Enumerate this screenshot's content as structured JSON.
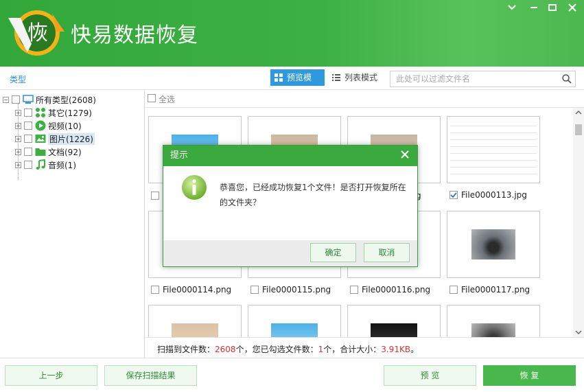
{
  "app": {
    "title": "快易数据恢复",
    "logo_char": "恢"
  },
  "window_controls": {
    "minimize": "—",
    "maximize": "□",
    "close": "✕"
  },
  "toolbar": {
    "type_label": "类型",
    "preview_mode": "预览模式",
    "list_mode": "列表模式",
    "filter_placeholder": "此处可以过滤文件名"
  },
  "tree": {
    "root": "所有类型(2608)",
    "items": [
      {
        "label": "其它(1279)",
        "icon": "apps-icon"
      },
      {
        "label": "视频(10)",
        "icon": "video-icon"
      },
      {
        "label": "图片(1226)",
        "icon": "image-icon",
        "selected": true
      },
      {
        "label": "文档(92)",
        "icon": "folder-icon"
      },
      {
        "label": "音频(1)",
        "icon": "music-icon"
      }
    ]
  },
  "grid": {
    "select_all": "全选",
    "row1_names": [
      "",
      "",
      ".png",
      "File0000113.jpg"
    ],
    "row2_names": [
      "File0000114.png",
      "File0000115.png",
      "File0000116.png",
      "File0000117.png"
    ]
  },
  "status": {
    "scanned_label": "扫描到文件数：",
    "scanned_count": "2608",
    "selected_label": "个，您已勾选文件数：",
    "selected_count": "1",
    "size_label": "个，合计大小：",
    "size_value": "3.91KB",
    "end": "。"
  },
  "footer": {
    "prev": "上一步",
    "save_scan": "保存扫描结果",
    "preview": "预 览",
    "recover": "恢 复"
  },
  "dialog": {
    "title": "提示",
    "message": "恭喜您，已经成功恢复1个文件！是否打开恢复所在的文件夹？",
    "ok": "确定",
    "cancel": "取消"
  },
  "colors": {
    "brand_green": "#3cb043",
    "accent_blue": "#2f99dd",
    "count_red": "#e0302e"
  }
}
